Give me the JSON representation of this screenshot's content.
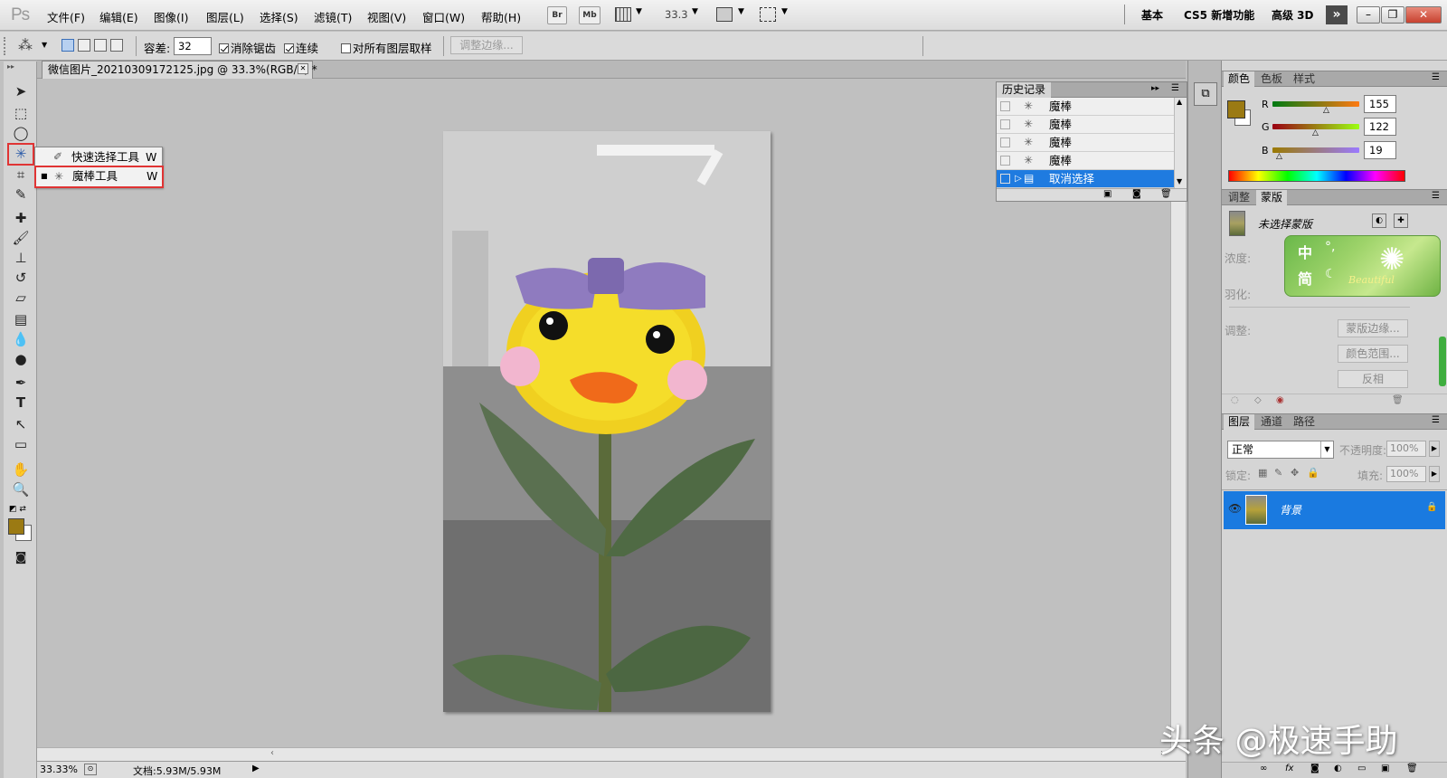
{
  "app": {
    "logo": "Ps"
  },
  "menu": [
    "文件(F)",
    "编辑(E)",
    "图像(I)",
    "图层(L)",
    "选择(S)",
    "滤镜(T)",
    "视图(V)",
    "窗口(W)",
    "帮助(H)"
  ],
  "menubar_icons": {
    "bridge": "Br",
    "minibridge": "Mb",
    "zoom": "33.3"
  },
  "workspaces": [
    "基本",
    "CS5 新增功能",
    "高级 3D"
  ],
  "options": {
    "tolerance_label": "容差:",
    "tolerance_value": "32",
    "antialias": "消除锯齿",
    "contiguous": "连续",
    "sample_all": "对所有图层取样",
    "refine_edge": "调整边缘..."
  },
  "document": {
    "tab_title": "微信图片_20210309172125.jpg @ 33.3%(RGB/8) *",
    "zoom": "33.33%",
    "doc_size": "文档:5.93M/5.93M"
  },
  "tool_popup": [
    {
      "label": "快速选择工具",
      "shortcut": "W",
      "icon": "quick-selection-icon"
    },
    {
      "label": "魔棒工具",
      "shortcut": "W",
      "icon": "magic-wand-icon",
      "selected": true
    }
  ],
  "history": {
    "title": "历史记录",
    "items": [
      "魔棒",
      "魔棒",
      "魔棒",
      "魔棒",
      "取消选择"
    ]
  },
  "color_panel": {
    "tabs": [
      "颜色",
      "色板",
      "样式"
    ],
    "r_label": "R",
    "r": "155",
    "g_label": "G",
    "g": "122",
    "b_label": "B",
    "b": "19",
    "foreground": "#9b7a13"
  },
  "masks_panel": {
    "tabs": [
      "调整",
      "蒙版"
    ],
    "title": "未选择蒙版",
    "density": "浓度:",
    "feather": "羽化:",
    "adjust": "调整:",
    "btn_mask_edge": "蒙版边缘...",
    "btn_color_range": "颜色范围...",
    "btn_invert": "反相"
  },
  "ime": {
    "chinese": "中",
    "simplified": "简",
    "brand": "Beautiful"
  },
  "layers_panel": {
    "tabs": [
      "图层",
      "通道",
      "路径"
    ],
    "blend_mode": "正常",
    "opacity_label": "不透明度:",
    "opacity": "100%",
    "lock_label": "锁定:",
    "fill_label": "填充:",
    "fill": "100%",
    "layer_name": "背景"
  },
  "watermark": "头条 @极速手助"
}
